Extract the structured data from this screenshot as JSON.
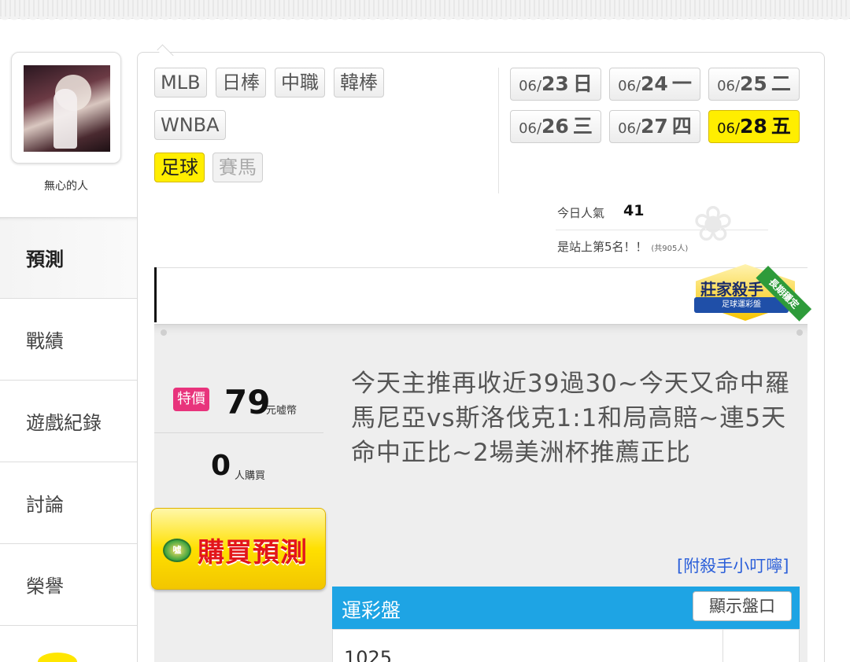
{
  "profile": {
    "username": "無心的人"
  },
  "sidebar": {
    "items": [
      {
        "label": "預測",
        "active": true
      },
      {
        "label": "戰績",
        "active": false
      },
      {
        "label": "遊戲紀錄",
        "active": false
      },
      {
        "label": "討論",
        "active": false
      },
      {
        "label": "榮譽",
        "active": false
      }
    ]
  },
  "sports": {
    "items": [
      {
        "label": "MLB"
      },
      {
        "label": "日棒"
      },
      {
        "label": "中職"
      },
      {
        "label": "韓棒"
      },
      {
        "label": "WNBA"
      },
      {
        "label": "足球",
        "active": true
      },
      {
        "label": "賽馬",
        "disabled": true
      }
    ]
  },
  "dates": {
    "items": [
      {
        "md": "06/",
        "day": "23",
        "weekday": "日"
      },
      {
        "md": "06/",
        "day": "24",
        "weekday": "一"
      },
      {
        "md": "06/",
        "day": "25",
        "weekday": "二"
      },
      {
        "md": "06/",
        "day": "26",
        "weekday": "三"
      },
      {
        "md": "06/",
        "day": "27",
        "weekday": "四"
      },
      {
        "md": "06/",
        "day": "28",
        "weekday": "五",
        "active": true
      }
    ]
  },
  "stats": {
    "popularity_label": "今日人氣",
    "popularity_value": "41",
    "rank_text": "是站上第5名！！",
    "rank_total": "(共905人)"
  },
  "badge": {
    "title": "莊家殺手",
    "subtitle": "足球運彩盤",
    "corner": "長期穩定"
  },
  "offer": {
    "sale_tag": "特價",
    "price": "79",
    "price_unit": "元嘘幣",
    "buyers": "0",
    "buyers_unit": "人購買",
    "buy_button": "購買預測",
    "coin_text": "噓"
  },
  "prediction": {
    "description": "今天主推再收近39過30~今天又命中羅馬尼亞vs斯洛伐克1:1和局高賠~連5天命中正比~2場美洲杯推薦正比",
    "tip_link": "[附殺手小叮嚀]"
  },
  "odds": {
    "title": "運彩盤",
    "show_button": "顯示盤口",
    "rows": [
      {
        "value": "1025"
      }
    ]
  }
}
